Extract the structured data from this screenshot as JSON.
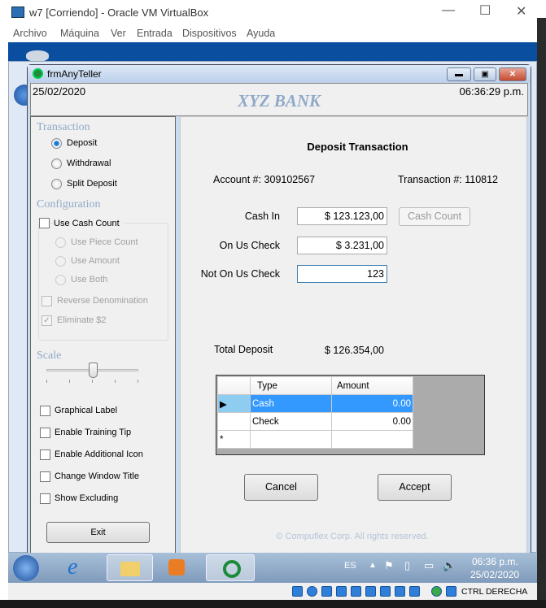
{
  "host": {
    "title": "w7 [Corriendo] - Oracle VM VirtualBox",
    "menu": [
      "Archivo",
      "Máquina",
      "Ver",
      "Entrada",
      "Dispositivos",
      "Ayuda"
    ],
    "status_key": "CTRL DERECHA"
  },
  "app": {
    "title": "frmAnyTeller",
    "date": "25/02/2020",
    "time": "06:36:29 p.m.",
    "bank": "XYZ BANK"
  },
  "left": {
    "transaction_label": "Transaction",
    "transaction_options": [
      {
        "label": "Deposit",
        "selected": true
      },
      {
        "label": "Withdrawal",
        "selected": false
      },
      {
        "label": "Split Deposit",
        "selected": false
      }
    ],
    "configuration_label": "Configuration",
    "use_cash_count": "Use Cash Count",
    "count_options": [
      "Use Piece Count",
      "Use Amount",
      "Use Both"
    ],
    "reverse_denomination": "Reverse Denomination",
    "eliminate_2": "Eliminate $2",
    "eliminate_2_checked": true,
    "scale_label": "Scale",
    "scale_value_fraction": 0.5,
    "options": [
      "Graphical Label",
      "Enable Training Tip",
      "Enable Additional Icon",
      "Change Window Title",
      "Show Excluding"
    ],
    "exit": "Exit"
  },
  "main": {
    "heading": "Deposit Transaction",
    "account": "Account #: 309102567",
    "transaction_no": "Transaction #:  110812",
    "cash_in_label": "Cash In",
    "cash_in": "$ 123.123,00",
    "cash_count": "Cash Count",
    "on_us_label": "On Us Check",
    "on_us": "$ 3.231,00",
    "not_on_us_label": "Not On Us Check",
    "not_on_us": "123",
    "total_label": "Total Deposit",
    "total": "$ 126.354,00",
    "grid": {
      "headers": [
        "Type",
        "Amount"
      ],
      "rows": [
        [
          "Cash",
          "0.00"
        ],
        [
          "Check",
          "0.00"
        ]
      ],
      "new_row": "*"
    },
    "cancel": "Cancel",
    "accept": "Accept",
    "copyright": "© Compuflex Corp. All rights reserved."
  },
  "taskbar": {
    "lang": "ES",
    "time": "06:36 p.m.",
    "date": "25/02/2020"
  }
}
